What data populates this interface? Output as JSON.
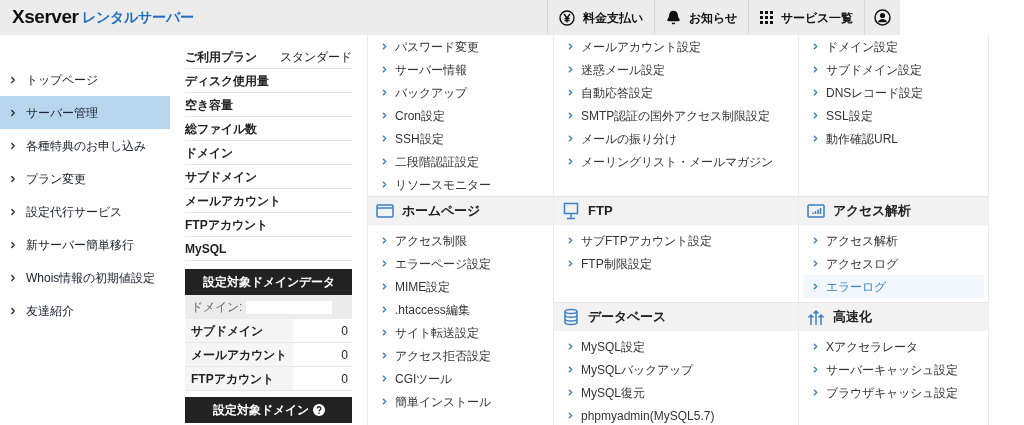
{
  "header": {
    "logo": {
      "brand": "Xserver",
      "product": "レンタルサーバー"
    },
    "buttons": [
      {
        "kind": "payment",
        "label": "料金支払い"
      },
      {
        "kind": "notice",
        "label": "お知らせ"
      },
      {
        "kind": "services",
        "label": "サービス一覧"
      },
      {
        "kind": "account"
      }
    ]
  },
  "sidebar": {
    "items": [
      {
        "label": "トップページ",
        "selected": false
      },
      {
        "label": "サーバー管理",
        "selected": true
      },
      {
        "label": "各種特典のお申し込み",
        "selected": false
      },
      {
        "label": "プラン変更",
        "selected": false
      },
      {
        "label": "設定代行サービス",
        "selected": false
      },
      {
        "label": "新サーバー簡単移行",
        "selected": false
      },
      {
        "label": "Whois情報の初期値設定",
        "selected": false
      },
      {
        "label": "友達紹介",
        "selected": false
      }
    ]
  },
  "server_info": {
    "rows": [
      {
        "label": "ご利用プラン",
        "value": "スタンダード"
      },
      {
        "label": "ディスク使用量"
      },
      {
        "label": "空き容量"
      },
      {
        "label": "総ファイル数"
      },
      {
        "label": "ドメイン"
      },
      {
        "label": "サブドメイン"
      },
      {
        "label": "メールアカウント"
      },
      {
        "label": "FTPアカウント"
      },
      {
        "label": "MySQL"
      }
    ]
  },
  "domain_data": {
    "title": "設定対象ドメインデータ",
    "domain_label": "ドメイン:",
    "rows": [
      {
        "label": "サブドメイン",
        "value": "0"
      },
      {
        "label": "メールアカウント",
        "value": "0"
      },
      {
        "label": "FTPアカウント",
        "value": "0"
      }
    ]
  },
  "domain_setting": {
    "title": "設定対象ドメイン"
  },
  "menu": {
    "columns": [
      {
        "sections": [
          {
            "items": [
              {
                "label": "パスワード変更",
                "selected": false
              },
              {
                "label": "サーバー情報",
                "selected": false
              },
              {
                "label": "バックアップ",
                "selected": false
              },
              {
                "label": "Cron設定",
                "selected": false
              },
              {
                "label": "SSH設定",
                "selected": false
              },
              {
                "label": "二段階認証設定",
                "selected": false
              },
              {
                "label": "リソースモニター",
                "selected": false
              }
            ]
          },
          {
            "kind": "window",
            "title": "ホームページ",
            "items": [
              {
                "label": "アクセス制限",
                "selected": false
              },
              {
                "label": "エラーページ設定",
                "selected": false
              },
              {
                "label": "MIME設定",
                "selected": false
              },
              {
                "label": ".htaccess編集",
                "selected": false
              },
              {
                "label": "サイト転送設定",
                "selected": false
              },
              {
                "label": "アクセス拒否設定",
                "selected": false
              },
              {
                "label": "CGIツール",
                "selected": false
              },
              {
                "label": "簡単インストール",
                "selected": false
              }
            ]
          }
        ]
      },
      {
        "sections": [
          {
            "items": [
              {
                "label": "メールアカウント設定",
                "selected": false
              },
              {
                "label": "迷惑メール設定",
                "selected": false
              },
              {
                "label": "自動応答設定",
                "selected": false
              },
              {
                "label": "SMTP認証の国外アクセス制限設定",
                "selected": false
              },
              {
                "label": "メールの振り分け",
                "selected": false
              },
              {
                "label": "メーリングリスト・メールマガジン",
                "selected": false
              }
            ]
          },
          {
            "kind": "monitor",
            "title": "FTP",
            "items": [
              {
                "label": "サブFTPアカウント設定",
                "selected": false
              },
              {
                "label": "FTP制限設定",
                "selected": false
              }
            ]
          },
          {
            "kind": "database",
            "title": "データベース",
            "items": [
              {
                "label": "MySQL設定",
                "selected": false
              },
              {
                "label": "MySQLバックアップ",
                "selected": false
              },
              {
                "label": "MySQL復元",
                "selected": false
              },
              {
                "label": "phpmyadmin(MySQL5.7)",
                "selected": false
              }
            ]
          }
        ]
      },
      {
        "sections": [
          {
            "items": [
              {
                "label": "ドメイン設定",
                "selected": false
              },
              {
                "label": "サブドメイン設定",
                "selected": false
              },
              {
                "label": "DNSレコード設定",
                "selected": false
              },
              {
                "label": "SSL設定",
                "selected": false
              },
              {
                "label": "動作確認URL",
                "selected": false
              }
            ]
          },
          {
            "kind": "chart",
            "title": "アクセス解析",
            "items": [
              {
                "label": "アクセス解析",
                "selected": false
              },
              {
                "label": "アクセスログ",
                "selected": false
              },
              {
                "label": "エラーログ",
                "selected": true
              }
            ]
          },
          {
            "kind": "speed",
            "title": "高速化",
            "items": [
              {
                "label": "Xアクセラレータ",
                "selected": false
              },
              {
                "label": "サーバーキャッシュ設定",
                "selected": false
              },
              {
                "label": "ブラウザキャッシュ設定",
                "selected": false
              }
            ]
          }
        ]
      }
    ]
  }
}
